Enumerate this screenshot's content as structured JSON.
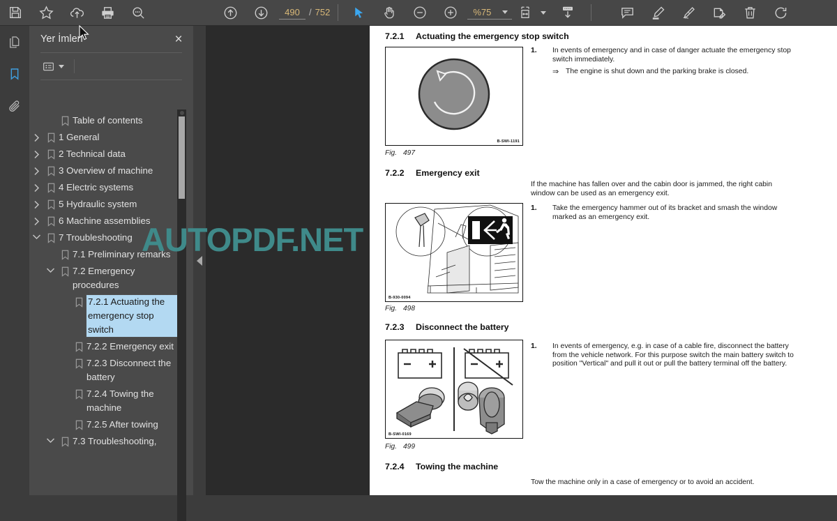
{
  "toolbar": {
    "buttons_left": [
      {
        "name": "save-icon",
        "label": "Save"
      },
      {
        "name": "favorite-star-icon",
        "label": "Add to favorites"
      },
      {
        "name": "cloud-upload-icon",
        "label": "Upload to cloud"
      },
      {
        "name": "print-icon",
        "label": "Print"
      },
      {
        "name": "search-icon",
        "label": "Search"
      }
    ],
    "prev_page_label": "Previous page",
    "next_page_label": "Next page",
    "page_current": "490",
    "page_separator": "/",
    "page_total": "752",
    "cursor_tool_label": "Select tool",
    "hand_tool_label": "Pan tool",
    "zoom_out_label": "Zoom out",
    "zoom_in_label": "Zoom in",
    "zoom_value": "%75",
    "fit_label": "Fit page width",
    "download_label": "Download",
    "buttons_right": [
      {
        "name": "comment-icon",
        "label": "Comment"
      },
      {
        "name": "highlighter-icon",
        "label": "Highlight"
      },
      {
        "name": "signature-icon",
        "label": "Sign"
      },
      {
        "name": "stamp-edit-icon",
        "label": "Edit annotation"
      },
      {
        "name": "trash-icon",
        "label": "Delete"
      },
      {
        "name": "rotate-icon",
        "label": "Rotate"
      }
    ]
  },
  "rail": {
    "items": [
      {
        "name": "pages-icon",
        "label": "Page thumbnails",
        "selected": false
      },
      {
        "name": "bookmark-icon",
        "label": "Bookmarks",
        "selected": true
      },
      {
        "name": "attachment-icon",
        "label": "Attachments",
        "selected": false
      }
    ]
  },
  "panel": {
    "title": "Yer İmleri",
    "close_label": "×",
    "options_label": "Bookmark options",
    "collapse_label": "Collapse panel"
  },
  "bookmarks": [
    {
      "label": "Table of contents",
      "indent": 1,
      "twisty": "none",
      "selected": false
    },
    {
      "label": "1 General",
      "indent": 0,
      "twisty": "collapsed",
      "selected": false
    },
    {
      "label": "2 Technical data",
      "indent": 0,
      "twisty": "collapsed",
      "selected": false
    },
    {
      "label": "3 Overview of machine",
      "indent": 0,
      "twisty": "collapsed",
      "selected": false
    },
    {
      "label": "4 Electric systems",
      "indent": 0,
      "twisty": "collapsed",
      "selected": false
    },
    {
      "label": "5 Hydraulic system",
      "indent": 0,
      "twisty": "collapsed",
      "selected": false
    },
    {
      "label": "6 Machine assemblies",
      "indent": 0,
      "twisty": "collapsed",
      "selected": false
    },
    {
      "label": "7 Troubleshooting",
      "indent": 0,
      "twisty": "expanded",
      "selected": false
    },
    {
      "label": "7.1 Preliminary remarks",
      "indent": 1,
      "twisty": "none",
      "selected": false
    },
    {
      "label": "7.2 Emergency procedures",
      "indent": 1,
      "twisty": "expanded",
      "selected": false
    },
    {
      "label": "7.2.1 Actuating the emergency stop switch",
      "indent": 2,
      "twisty": "none",
      "selected": true
    },
    {
      "label": "7.2.2 Emergency exit",
      "indent": 2,
      "twisty": "none",
      "selected": false
    },
    {
      "label": "7.2.3 Disconnect the battery",
      "indent": 2,
      "twisty": "none",
      "selected": false
    },
    {
      "label": "7.2.4 Towing the machine",
      "indent": 2,
      "twisty": "none",
      "selected": false
    },
    {
      "label": "7.2.5 After towing",
      "indent": 2,
      "twisty": "none",
      "selected": false
    },
    {
      "label": "7.3 Troubleshooting,",
      "indent": 1,
      "twisty": "expanded",
      "selected": false
    }
  ],
  "document": {
    "watermark": "AUTOPDF.NET",
    "watermark_color": "#3f8a8a",
    "sections": [
      {
        "number": "7.2.1",
        "title": "Actuating the emergency stop switch",
        "figure_caption_prefix": "Fig.",
        "figure_number": "497",
        "image_code": "B-SWI-1191",
        "step_number": "1.",
        "step_text": "In events of emergency and in case of danger actuate the emergency stop switch immediately.",
        "result_glyph": "⇒",
        "result_text": "The engine is shut down and the parking brake is closed."
      },
      {
        "number": "7.2.2",
        "title": "Emergency exit",
        "figure_caption_prefix": "Fig.",
        "figure_number": "498",
        "image_code": "B-930-0094",
        "intro_text": "If the machine has fallen over and the cabin door is jammed, the right cabin window can be used as an emergency exit.",
        "step_number": "1.",
        "step_text": "Take the emergency hammer out of its bracket and smash the window marked as an emergency exit."
      },
      {
        "number": "7.2.3",
        "title": "Disconnect the battery",
        "figure_caption_prefix": "Fig.",
        "figure_number": "499",
        "image_code": "B-SWI-0169",
        "step_number": "1.",
        "step_text": "In events of emergency, e.g. in case of a cable fire, disconnect the battery from the vehicle network. For this purpose switch the main battery switch to position \"Vertical\" and pull it out or pull the battery terminal off the battery."
      },
      {
        "number": "7.2.4",
        "title": "Towing the machine",
        "intro_text": "Tow the machine only in a case of emergency or to avoid an accident."
      }
    ]
  }
}
